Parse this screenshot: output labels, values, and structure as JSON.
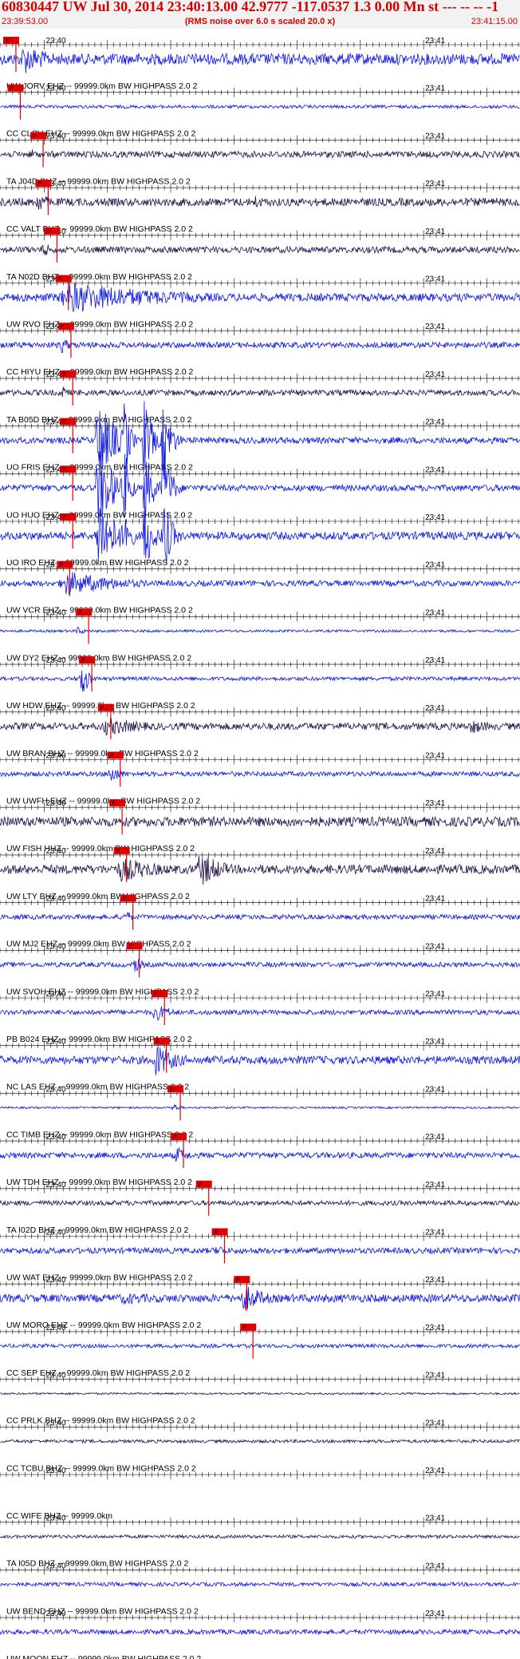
{
  "header": {
    "title": "60830447 UW Jul 30, 2014 23:40:13.00   42.9777 -117.0537  1.3 0.00 Mn st --- -- --  -1",
    "subtitle": "(RMS noise over 6.0 s scaled 20.0 x)",
    "start_time": "23:39:53.00",
    "end_time": "23:41:15.00"
  },
  "colors": {
    "header_text": "#d40000",
    "header_bg": "#f2f2f2",
    "blue_trace": "#0a14e6",
    "dark_trace": "#22104a",
    "pick": "#e00000",
    "axis": "#000000"
  },
  "chart_data": {
    "type": "line",
    "x_range_seconds": [
      0,
      82
    ],
    "x_start": "23:39:53.00",
    "x_end": "23:41:15.00",
    "tick_labels": [
      "23:40",
      "23:41"
    ],
    "pick_label": "P",
    "traces": [
      {
        "label": "UW JORV EHZ -- 99999.0km BW  HIGHPASS  2.0  2",
        "pick_s": 0.5,
        "color": "blue",
        "amp": 0.35,
        "bursts": [
          [
            3,
            5,
            1.0
          ]
        ]
      },
      {
        "label": "CC CLCV EHZ -- 99999.0km BW  HIGHPASS  2.0  2",
        "pick_s": 1.2,
        "color": "blue",
        "amp": 0.1,
        "bursts": []
      },
      {
        "label": "TA J04D BHZ -- 99999.0km BW  HIGHPASS  2.0  2",
        "pick_s": 4.8,
        "color": "dark",
        "amp": 0.2,
        "bursts": [
          [
            4.6,
            1.5,
            0.45
          ]
        ]
      },
      {
        "label": "CC VALT BHZ -- 99999.0km BW  HIGHPASS  2.0  2",
        "pick_s": 5.6,
        "color": "dark",
        "amp": 0.25,
        "bursts": [
          [
            5.5,
            2.5,
            0.7
          ],
          [
            40,
            2,
            0.5
          ]
        ]
      },
      {
        "label": "TA N02D BHZ -- 99999.0km BW  HIGHPASS  2.0  2",
        "pick_s": 7.0,
        "color": "dark",
        "amp": 0.2,
        "bursts": [
          [
            6.5,
            2,
            0.5
          ]
        ]
      },
      {
        "label": "UW RVO EHZ -- 99999.0km BW  HIGHPASS  2.0  2",
        "pick_s": 8.8,
        "color": "blue",
        "amp": 0.25,
        "bursts": [
          [
            8.5,
            18,
            1.0
          ],
          [
            34,
            10,
            0.2
          ]
        ]
      },
      {
        "label": "CC HIYU EHZ -- 99999.0km BW  HIGHPASS  2.0  2",
        "pick_s": 9.2,
        "color": "blue",
        "amp": 0.18,
        "bursts": [
          [
            9.5,
            1.5,
            0.6
          ]
        ]
      },
      {
        "label": "TA B05D BHZ -- 99999.0km BW  HIGHPASS  2.0  2",
        "pick_s": 9.5,
        "color": "dark",
        "amp": 0.18,
        "bursts": [
          [
            9.5,
            1.5,
            0.5
          ]
        ]
      },
      {
        "label": "UO FRIS EHZ -- 99999.0km BW  HIGHPASS  2.0  2",
        "pick_s": 9.5,
        "color": "blue",
        "amp": 0.2,
        "bursts": [
          [
            15,
            3,
            2.8
          ],
          [
            19.5,
            1,
            2.8
          ],
          [
            22.5,
            1.5,
            2.8
          ],
          [
            25.5,
            1.5,
            2.8
          ]
        ]
      },
      {
        "label": "UO HUO EHZ -- 99999.0km BW  HIGHPASS  2.0  2",
        "pick_s": 9.5,
        "color": "blue",
        "amp": 0.2,
        "bursts": [
          [
            15,
            3,
            2.8
          ],
          [
            19.5,
            1,
            2.8
          ],
          [
            22.5,
            1.5,
            2.8
          ],
          [
            25.5,
            1.5,
            2.8
          ]
        ]
      },
      {
        "label": "UO IRO EHZ -- 99999.0km BW  HIGHPASS  2.0  2",
        "pick_s": 9.5,
        "color": "blue",
        "amp": 0.25,
        "bursts": [
          [
            15,
            3,
            2.8
          ],
          [
            19.5,
            1,
            2.8
          ],
          [
            22.5,
            1.5,
            2.8
          ],
          [
            25.5,
            1.5,
            2.8
          ]
        ]
      },
      {
        "label": "UW VCR EHZ -- 99999.0km BW  HIGHPASS  2.0  2",
        "pick_s": 9.0,
        "color": "blue",
        "amp": 0.18,
        "bursts": [
          [
            9,
            10,
            0.8
          ]
        ]
      },
      {
        "label": "UW DY2 EHZ -- 99999.0km BW  HIGHPASS  2.0  2",
        "pick_s": 12.0,
        "color": "blue",
        "amp": 0.08,
        "bursts": [
          [
            12,
            1.5,
            0.3
          ]
        ]
      },
      {
        "label": "UW HDW EHZ -- 99999.0km BW  HIGHPASS  2.0  2",
        "pick_s": 12.5,
        "color": "blue",
        "amp": 0.12,
        "bursts": [
          [
            12.5,
            1.2,
            1.6
          ]
        ]
      },
      {
        "label": "UW BRAN BHZ -- 99999.0km BW  HIGHPASS  2.0  2",
        "pick_s": 15.5,
        "color": "dark",
        "amp": 0.22,
        "bursts": [
          [
            15.5,
            8,
            0.6
          ],
          [
            74,
            4,
            0.5
          ]
        ]
      },
      {
        "label": "UW UWFH EHZ -- 99999.0km BW  HIGHPASS  2.0  2",
        "pick_s": 17.0,
        "color": "blue",
        "amp": 0.15,
        "bursts": [
          [
            17,
            2,
            0.7
          ]
        ]
      },
      {
        "label": "UW FISH HHZ -- 99999.0km BW  HIGHPASS  2.0  2",
        "pick_s": 17.3,
        "color": "dark",
        "amp": 0.3,
        "bursts": []
      },
      {
        "label": "UW LTY BHZ -- 99999.0km BW  HIGHPASS  2.0  2",
        "pick_s": 18.0,
        "color": "dark",
        "amp": 0.28,
        "bursts": [
          [
            18,
            8,
            0.8
          ],
          [
            31,
            4,
            1.2
          ]
        ]
      },
      {
        "label": "UW MJ2 EHZ -- 99999.0km BW  HIGHPASS  2.0  2",
        "pick_s": 19.0,
        "color": "blue",
        "amp": 0.15,
        "bursts": [
          [
            19.5,
            1.5,
            0.5
          ]
        ]
      },
      {
        "label": "UW SVOH EHZ -- 99999.0km BW  HIGHPASS  2.0  2",
        "pick_s": 20.0,
        "color": "blue",
        "amp": 0.15,
        "bursts": [
          [
            21,
            1.5,
            0.6
          ]
        ]
      },
      {
        "label": "PB B024 EHZ -- 99999.0km BW  HIGHPASS  2.0  2",
        "pick_s": 24.0,
        "color": "blue",
        "amp": 0.15,
        "bursts": [
          [
            24,
            3,
            0.6
          ]
        ]
      },
      {
        "label": "NC LAS EHZ -- 99999.0km BW  HIGHPASS  2.0  2",
        "pick_s": 24.3,
        "color": "blue",
        "amp": 0.25,
        "bursts": [
          [
            24,
            4,
            1.1
          ]
        ]
      },
      {
        "label": "CC TIMB EHZ -- 99999.0km BW  HIGHPASS  2.0  2",
        "pick_s": 26.5,
        "color": "blue",
        "amp": 0.06,
        "bursts": [
          [
            27,
            1.5,
            0.3
          ]
        ]
      },
      {
        "label": "UW TDH EHZ -- 99999.0km BW  HIGHPASS  2.0  2",
        "pick_s": 27.0,
        "color": "blue",
        "amp": 0.18,
        "bursts": [
          [
            27.5,
            2.5,
            0.6
          ]
        ]
      },
      {
        "label": "TA I02D BHZ -- 99999.0km BW  HIGHPASS  2.0  2",
        "pick_s": 31.0,
        "color": "dark",
        "amp": 0.15,
        "bursts": []
      },
      {
        "label": "UW WAT EHZ -- 99999.0km BW  HIGHPASS  2.0  2",
        "pick_s": 33.5,
        "color": "blue",
        "amp": 0.18,
        "bursts": [
          [
            34,
            1.5,
            0.5
          ]
        ]
      },
      {
        "label": "UW MORO EHZ -- 99999.0km BW  HIGHPASS  2.0  2",
        "pick_s": 37.0,
        "color": "blue",
        "amp": 0.25,
        "bursts": [
          [
            38,
            4,
            0.9
          ],
          [
            18,
            10,
            0.4
          ]
        ]
      },
      {
        "label": "CC SEP EHZ -- 99999.0km BW  HIGHPASS  2.0  2",
        "pick_s": 38.0,
        "color": "blue",
        "amp": 0.12,
        "bursts": []
      },
      {
        "label": "CC PRLK BHZ -- 99999.0km BW  HIGHPASS  2.0  2",
        "pick_s": null,
        "color": "dark",
        "amp": 0.06,
        "bursts": []
      },
      {
        "label": "CC TCBU BHZ -- 99999.0km BW  HIGHPASS  2.0  2",
        "pick_s": null,
        "color": "dark",
        "amp": 0.1,
        "bursts": []
      },
      {
        "label": "CC WIFE BHZ -- 99999.0km",
        "pick_s": null,
        "color": "dark",
        "amp": 0.0,
        "bursts": []
      },
      {
        "label": "TA I05D BHZ -- 99999.0km BW  HIGHPASS  2.0  2",
        "pick_s": null,
        "color": "dark",
        "amp": 0.1,
        "bursts": []
      },
      {
        "label": "UW BEND EHZ -- 99999.0km BW  HIGHPASS  2.0  2",
        "pick_s": null,
        "color": "blue",
        "amp": 0.12,
        "bursts": []
      },
      {
        "label": "UW MOON EHZ -- 99999.0km BW  HIGHPASS  2.0  2",
        "pick_s": null,
        "color": "blue",
        "amp": 0.15,
        "bursts": []
      }
    ]
  }
}
